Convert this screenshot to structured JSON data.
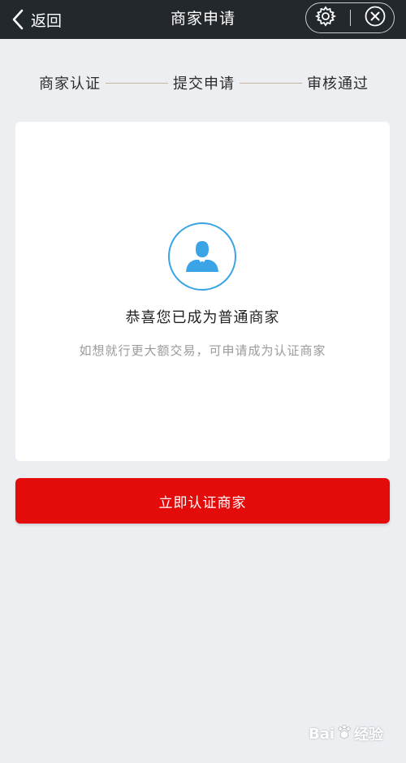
{
  "nav": {
    "back_label": "返回",
    "title": "商家申请",
    "back_icon": "chevron-left-icon",
    "settings_icon": "gear-icon",
    "close_icon": "close-circle-icon"
  },
  "steps": [
    {
      "label": "商家认证"
    },
    {
      "label": "提交申请"
    },
    {
      "label": "审核通过"
    }
  ],
  "card": {
    "avatar_icon": "user-avatar-icon",
    "title": "恭喜您已成为普通商家",
    "subtitle": "如想就行更大额交易，可申请成为认证商家"
  },
  "cta": {
    "label": "立即认证商家"
  },
  "watermark": {
    "left": "Bai",
    "right": "经验"
  },
  "colors": {
    "topbar": "#23282d",
    "background": "#eceef1",
    "accent_red": "#e40b0b",
    "accent_blue": "#3aa4e6",
    "step_line": "#c8b49a"
  }
}
